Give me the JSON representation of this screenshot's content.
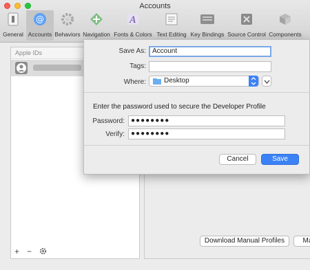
{
  "window": {
    "title": "Accounts"
  },
  "toolbar": {
    "items": [
      {
        "label": "General",
        "icon": "switch-icon",
        "active": false
      },
      {
        "label": "Accounts",
        "icon": "at-sign-icon",
        "active": true
      },
      {
        "label": "Behaviors",
        "icon": "gear-icon",
        "active": false
      },
      {
        "label": "Navigation",
        "icon": "arrows-icon",
        "active": false
      },
      {
        "label": "Fonts & Colors",
        "icon": "font-palette-icon",
        "active": false
      },
      {
        "label": "Text Editing",
        "icon": "text-edit-icon",
        "active": false
      },
      {
        "label": "Key Bindings",
        "icon": "keyboard-icon",
        "active": false
      },
      {
        "label": "Source Control",
        "icon": "source-control-icon",
        "active": false
      },
      {
        "label": "Components",
        "icon": "components-icon",
        "active": false
      }
    ]
  },
  "left_panel": {
    "header": "Apple IDs",
    "footer": {
      "add": "+",
      "remove": "−",
      "settings_icon": "gear-icon"
    }
  },
  "right_panel": {
    "download_button": "Download Manual Profiles",
    "manage_button": "Ma"
  },
  "sheet": {
    "save_as_label": "Save As:",
    "save_as_value": "Account",
    "tags_label": "Tags:",
    "tags_value": "",
    "where_label": "Where:",
    "where_value": "Desktop",
    "message": "Enter the password used to secure the Developer Profile",
    "password_label": "Password:",
    "password_value": "●●●●●●●●",
    "verify_label": "Verify:",
    "verify_value": "●●●●●●●●",
    "cancel_button": "Cancel",
    "save_button": "Save"
  },
  "colors": {
    "accent": "#3b82f6",
    "active_tab": "#c6c6c6"
  }
}
